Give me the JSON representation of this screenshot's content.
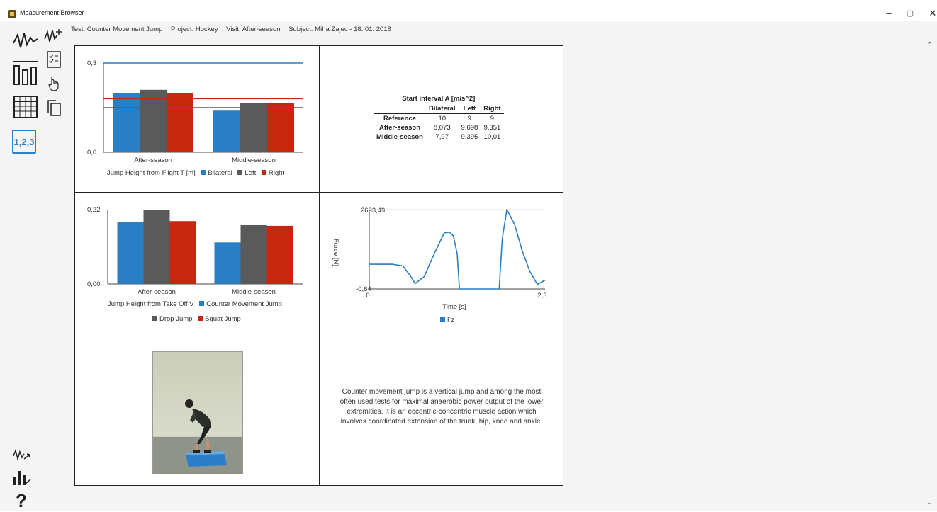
{
  "window": {
    "title": "Measurement Browser",
    "minimize": "–",
    "restore": "▢",
    "close": "✕"
  },
  "info": {
    "test": "Test: Counter Movement Jump",
    "project": "Project: Hockey",
    "visit": "Visit: After-season",
    "subject": "Subject: Miha Zajec - 18. 01. 2018"
  },
  "toolbar": {
    "numbers_label": "1,2,3",
    "help_label": "?"
  },
  "charts": {
    "flight": {
      "ytop": "0,3",
      "ybottom": "0,0",
      "cat1": "After-season",
      "cat2": "Middle-season",
      "legend_title": "Jump Height from Flight T [m]",
      "s1": "Bilateral",
      "s2": "Left",
      "s3": "Right"
    },
    "takeoff": {
      "ytop": "0,22",
      "ybottom": "0,00",
      "cat1": "After-season",
      "cat2": "Middle-season",
      "legend_title": "Jump Height from Take Off V",
      "s1": "Counter Movement Jump",
      "s2": "Drop Jump",
      "s3": "Squat Jump"
    },
    "force": {
      "ytop": "2693,49",
      "ybottom": "-0,64",
      "xleft": "0",
      "xright": "2,3",
      "xlabel": "Time [s]",
      "ylabel": "Force [N]",
      "series": "Fz"
    }
  },
  "chart_data": [
    {
      "type": "bar",
      "categories": [
        "After-season",
        "Middle-season"
      ],
      "series": [
        {
          "name": "Bilateral",
          "values": [
            0.2,
            0.14
          ]
        },
        {
          "name": "Left",
          "values": [
            0.21,
            0.165
          ]
        },
        {
          "name": "Right",
          "values": [
            0.2,
            0.165
          ]
        }
      ],
      "reference_lines": [
        0.3,
        0.18,
        0.15
      ],
      "ylim": [
        0,
        0.3
      ],
      "legend_title": "Jump Height from Flight T [m]",
      "colors": {
        "Bilateral": "#2a7fc4",
        "Left": "#5a5a5a",
        "Right": "#c8270f"
      }
    },
    {
      "type": "bar",
      "categories": [
        "After-season",
        "Middle-season"
      ],
      "series": [
        {
          "name": "Counter Movement Jump",
          "values": [
            0.184,
            0.123
          ]
        },
        {
          "name": "Drop Jump",
          "values": [
            0.22,
            0.174
          ]
        },
        {
          "name": "Squat Jump",
          "values": [
            0.186,
            0.172
          ]
        }
      ],
      "ylim": [
        0,
        0.22
      ],
      "legend_title": "Jump Height from Take Off V",
      "colors": {
        "Counter Movement Jump": "#2a7fc4",
        "Drop Jump": "#5a5a5a",
        "Squat Jump": "#c8270f"
      }
    },
    {
      "type": "line",
      "series": [
        {
          "name": "Fz"
        }
      ],
      "x": [
        0,
        0.1,
        0.3,
        0.44,
        0.55,
        0.6,
        0.72,
        0.85,
        0.98,
        1.05,
        1.1,
        1.15,
        1.18,
        1.4,
        1.6,
        1.7,
        1.74,
        1.8,
        1.9,
        2.0,
        2.1,
        2.2,
        2.3
      ],
      "y": [
        840,
        840,
        840,
        780,
        400,
        180,
        420,
        1200,
        1900,
        1930,
        1800,
        1200,
        0,
        0,
        0,
        0,
        1700,
        2693,
        2200,
        1300,
        600,
        150,
        300
      ],
      "xlim": [
        0,
        2.3
      ],
      "ylim": [
        -0.64,
        2693.49
      ],
      "xlabel": "Time [s]",
      "ylabel": "Force [N]",
      "color": "#2a7fc4"
    }
  ],
  "table": {
    "title": "Start interval A [m/s^2]",
    "headers": [
      "",
      "Bilateral",
      "Left",
      "Right"
    ],
    "rows": [
      [
        "Reference",
        "10",
        "9",
        "9"
      ],
      [
        "After-season",
        "8,073",
        "9,698",
        "9,351"
      ],
      [
        "Middle-season",
        "7,97",
        "9,395",
        "10,01"
      ]
    ]
  },
  "description": "Counter movement jump is a vertical jump and among the most often used tests for maximal anaerobic power output of the lower extremities. It is an eccentric-concentric muscle action which involves coordinated extension of the trunk, hip, knee and ankle.",
  "icons": [
    "waveform-icon",
    "add-waveform-icon",
    "bar-columns-icon",
    "checklist-icon",
    "hand-pointer-icon",
    "table-grid-icon",
    "copy-icon",
    "numbers-icon",
    "signal-arrow-icon",
    "chart-arrow-icon",
    "help-icon"
  ]
}
